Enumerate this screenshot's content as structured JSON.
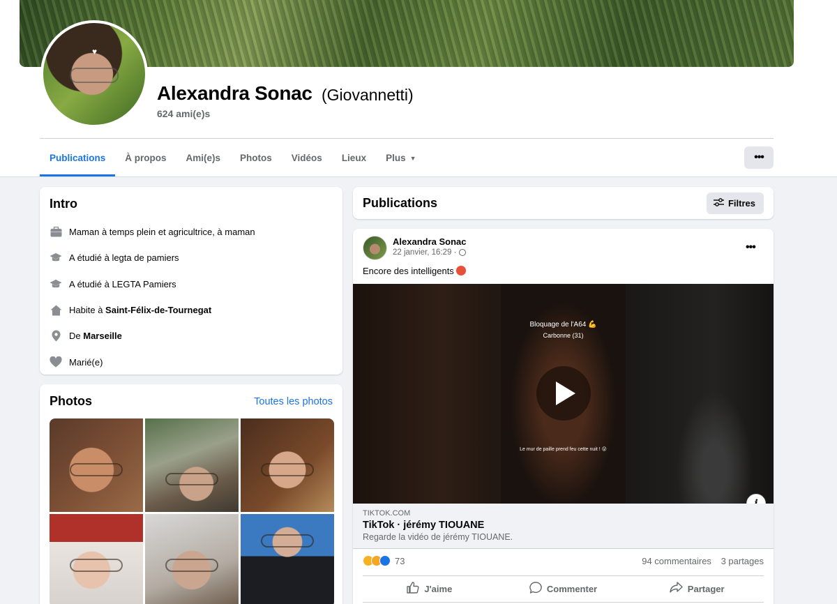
{
  "profile": {
    "name": "Alexandra Sonac",
    "alternate_name": "(Giovannetti)",
    "friends": "624 ami(e)s"
  },
  "tabs": [
    {
      "label": "Publications",
      "active": true
    },
    {
      "label": "À propos"
    },
    {
      "label": "Ami(e)s"
    },
    {
      "label": "Photos"
    },
    {
      "label": "Vidéos"
    },
    {
      "label": "Lieux"
    },
    {
      "label": "Plus"
    }
  ],
  "more_button": "•••",
  "intro": {
    "title": "Intro",
    "items": [
      {
        "icon": "briefcase-icon",
        "text": "Maman à temps plein et agricultrice, à maman",
        "bold": ""
      },
      {
        "icon": "graduation-cap-icon",
        "text": "A étudié à legta de pamiers",
        "bold": ""
      },
      {
        "icon": "graduation-cap-icon",
        "text": "A étudié à LEGTA Pamiers",
        "bold": ""
      },
      {
        "icon": "home-icon",
        "text": "Habite à ",
        "bold": "Saint-Félix-de-Tournegat"
      },
      {
        "icon": "location-pin-icon",
        "text": "De ",
        "bold": "Marseille"
      },
      {
        "icon": "heart-icon",
        "text": "Marié(e)",
        "bold": ""
      }
    ]
  },
  "photos": {
    "title": "Photos",
    "see_all": "Toutes les photos"
  },
  "publications": {
    "title": "Publications",
    "filter_label": "Filtres"
  },
  "post": {
    "author": "Alexandra Sonac",
    "date": "22 janvier, 16:29 ·",
    "text": "Encore des intelligents",
    "video_caption_1": "Bloquage de l'A64 💪",
    "video_caption_2": "Carbonne (31)",
    "video_caption_3": "Le mur de paille prend feu cette nuit ! 😮",
    "link_domain": "TIKTOK.COM",
    "link_title": "TikTok · jérémy TIOUANE",
    "link_desc": "Regarde la vidéo de jérémy TIOUANE.",
    "reaction_count": "73",
    "comments": "94 commentaires",
    "shares": "3 partages",
    "actions": {
      "like": "J'aime",
      "comment": "Commenter",
      "share": "Partager"
    }
  },
  "colors": {
    "accent": "#1b74e4",
    "background": "#f0f2f5",
    "secondary_text": "#65676b"
  }
}
